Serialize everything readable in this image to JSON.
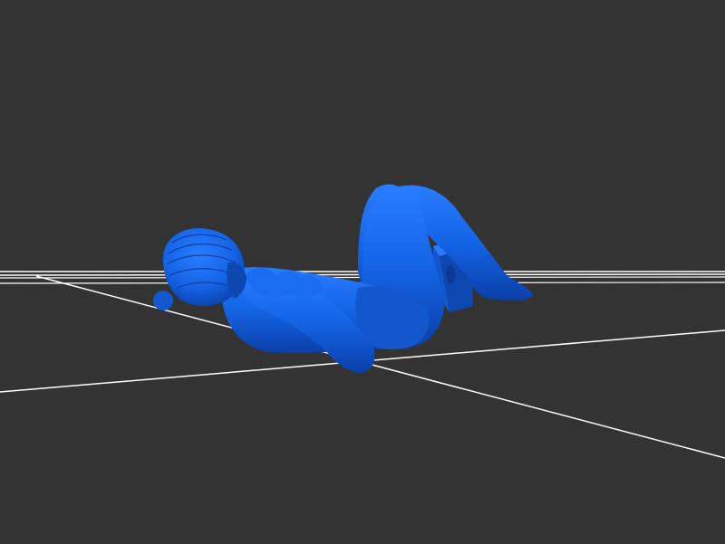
{
  "scene": {
    "background_color": "#333333",
    "grid_color": "#ffffff",
    "model_color": "#1464e6",
    "model_shadow_color": "#0b3fa8",
    "model_highlight_color": "#2a7cff",
    "subject": "figure-lying-supine-knees-bent",
    "prop": "block-under-knees"
  }
}
